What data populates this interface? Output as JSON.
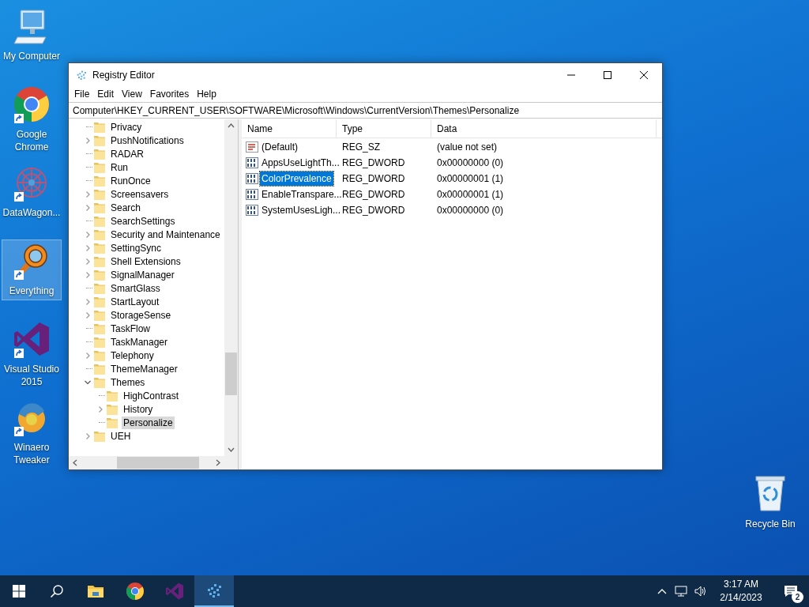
{
  "desktop_icons": [
    {
      "label": "My Computer",
      "kind": "computer",
      "shortcut": false,
      "selected": false
    },
    {
      "label": "Google Chrome",
      "kind": "chrome",
      "shortcut": true,
      "selected": false
    },
    {
      "label": "DataWagon...",
      "kind": "datawagon",
      "shortcut": true,
      "selected": false
    },
    {
      "label": "Everything",
      "kind": "everything",
      "shortcut": true,
      "selected": true
    },
    {
      "label": "Visual Studio 2015",
      "kind": "vs",
      "shortcut": true,
      "selected": false
    },
    {
      "label": "Winaero Tweaker",
      "kind": "winaero",
      "shortcut": true,
      "selected": false
    }
  ],
  "recycle_bin": {
    "label": "Recycle Bin"
  },
  "window": {
    "title": "Registry Editor",
    "menu": [
      "File",
      "Edit",
      "View",
      "Favorites",
      "Help"
    ],
    "address": "Computer\\HKEY_CURRENT_USER\\SOFTWARE\\Microsoft\\Windows\\CurrentVersion\\Themes\\Personalize",
    "tree": [
      {
        "label": "Privacy",
        "has_children": false,
        "selected": false
      },
      {
        "label": "PushNotifications",
        "has_children": true,
        "expanded": false,
        "selected": false
      },
      {
        "label": "RADAR",
        "has_children": false,
        "selected": false
      },
      {
        "label": "Run",
        "has_children": false,
        "selected": false
      },
      {
        "label": "RunOnce",
        "has_children": false,
        "selected": false
      },
      {
        "label": "Screensavers",
        "has_children": true,
        "expanded": false,
        "selected": false
      },
      {
        "label": "Search",
        "has_children": true,
        "expanded": false,
        "selected": false
      },
      {
        "label": "SearchSettings",
        "has_children": false,
        "selected": false
      },
      {
        "label": "Security and Maintenance",
        "has_children": true,
        "expanded": false,
        "selected": false
      },
      {
        "label": "SettingSync",
        "has_children": true,
        "expanded": false,
        "selected": false
      },
      {
        "label": "Shell Extensions",
        "has_children": true,
        "expanded": false,
        "selected": false
      },
      {
        "label": "SignalManager",
        "has_children": true,
        "expanded": false,
        "selected": false
      },
      {
        "label": "SmartGlass",
        "has_children": false,
        "selected": false
      },
      {
        "label": "StartLayout",
        "has_children": true,
        "expanded": false,
        "selected": false
      },
      {
        "label": "StorageSense",
        "has_children": true,
        "expanded": false,
        "selected": false
      },
      {
        "label": "TaskFlow",
        "has_children": false,
        "selected": false
      },
      {
        "label": "TaskManager",
        "has_children": false,
        "selected": false
      },
      {
        "label": "Telephony",
        "has_children": true,
        "expanded": false,
        "selected": false
      },
      {
        "label": "ThemeManager",
        "has_children": false,
        "selected": false
      },
      {
        "label": "Themes",
        "has_children": true,
        "expanded": true,
        "selected": false,
        "children": [
          {
            "label": "HighContrast",
            "has_children": false,
            "selected": false
          },
          {
            "label": "History",
            "has_children": true,
            "expanded": false,
            "selected": false
          },
          {
            "label": "Personalize",
            "has_children": false,
            "selected": true
          }
        ]
      },
      {
        "label": "UEH",
        "has_children": true,
        "expanded": false,
        "selected": false
      }
    ],
    "columns": [
      "Name",
      "Type",
      "Data"
    ],
    "values": [
      {
        "name": "(Default)",
        "kind": "string",
        "type": "REG_SZ",
        "data": "(value not set)",
        "selected": false
      },
      {
        "name": "AppsUseLightTh...",
        "kind": "dword",
        "type": "REG_DWORD",
        "data": "0x00000000 (0)",
        "selected": false
      },
      {
        "name": "ColorPrevalence",
        "kind": "dword",
        "type": "REG_DWORD",
        "data": "0x00000001 (1)",
        "selected": true
      },
      {
        "name": "EnableTranspare...",
        "kind": "dword",
        "type": "REG_DWORD",
        "data": "0x00000001 (1)",
        "selected": false
      },
      {
        "name": "SystemUsesLigh...",
        "kind": "dword",
        "type": "REG_DWORD",
        "data": "0x00000000 (0)",
        "selected": false
      }
    ]
  },
  "taskbar": {
    "apps": [
      {
        "kind": "explorer",
        "active": false
      },
      {
        "kind": "chrome",
        "active": false
      },
      {
        "kind": "vs",
        "active": false
      },
      {
        "kind": "regedit",
        "active": true
      }
    ],
    "time": "3:17 AM",
    "date": "2/14/2023",
    "notifications": "2"
  }
}
